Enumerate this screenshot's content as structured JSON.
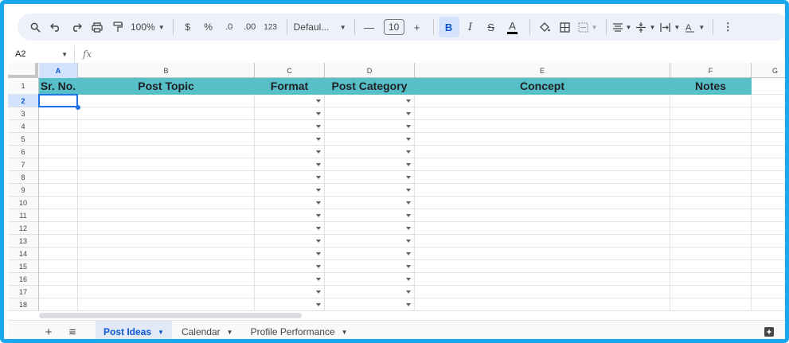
{
  "toolbar": {
    "zoom": "100%",
    "currency": "$",
    "percent": "%",
    "dec_decrease": ".0",
    "dec_increase": ".00",
    "number_format": "123",
    "font": "Defaul...",
    "font_size": "10",
    "bold": "B",
    "italic": "I",
    "strike": "S",
    "text_color": "A"
  },
  "formula_bar": {
    "name_box": "A2",
    "fx": "fx",
    "value": ""
  },
  "columns": [
    {
      "letter": "A",
      "header": "Sr. No.",
      "dropdown": false
    },
    {
      "letter": "B",
      "header": "Post Topic",
      "dropdown": false
    },
    {
      "letter": "C",
      "header": "Format",
      "dropdown": true
    },
    {
      "letter": "D",
      "header": "Post Category",
      "dropdown": true
    },
    {
      "letter": "E",
      "header": "Concept",
      "dropdown": false
    },
    {
      "letter": "F",
      "header": "Notes",
      "dropdown": false
    },
    {
      "letter": "G",
      "header": "",
      "dropdown": false
    }
  ],
  "rows": [
    "1",
    "2",
    "3",
    "4",
    "5",
    "6",
    "7",
    "8",
    "9",
    "10",
    "11",
    "12",
    "13",
    "14",
    "15",
    "16",
    "17",
    "18"
  ],
  "selected_cell": "A2",
  "header_color": "#56bfc8",
  "accent_color": "#1a73e8",
  "sheet_tabs": [
    {
      "label": "Post Ideas",
      "active": true
    },
    {
      "label": "Calendar",
      "active": false
    },
    {
      "label": "Profile Performance",
      "active": false
    }
  ]
}
